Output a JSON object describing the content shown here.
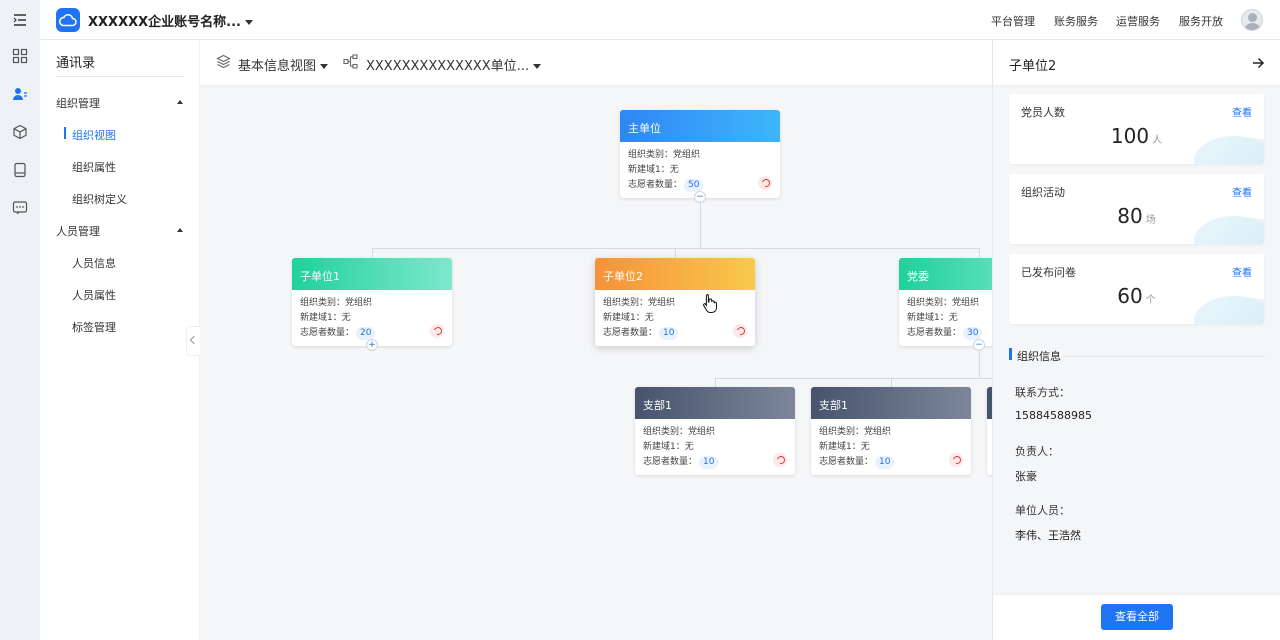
{
  "header": {
    "company": "XXXXXX企业账号名称...",
    "nav": [
      "平台管理",
      "账务服务",
      "运营服务",
      "服务开放"
    ]
  },
  "rail": {
    "icons": [
      "menu-icon",
      "grid-icon",
      "contacts-icon",
      "cube-icon",
      "device-icon",
      "message-icon"
    ]
  },
  "leftnav": {
    "title": "通讯录",
    "groups": [
      {
        "label": "组织管理",
        "items": [
          "组织视图",
          "组织属性",
          "组织树定义"
        ]
      },
      {
        "label": "人员管理",
        "items": [
          "人员信息",
          "人员属性",
          "标签管理"
        ]
      }
    ]
  },
  "canvas_head": {
    "view": "基本信息视图",
    "unit": "XXXXXXXXXXXXXX单位..."
  },
  "labels": {
    "category": "组织类别：",
    "field1": "新建域1：",
    "volunteers": "志愿者数量："
  },
  "cards": [
    {
      "title": "主单位",
      "category": "党组织",
      "field1": "无",
      "volunteers": "50",
      "toggle": "−"
    },
    {
      "title": "子单位1",
      "category": "党组织",
      "field1": "无",
      "volunteers": "20",
      "toggle": "+"
    },
    {
      "title": "子单位2",
      "category": "党组织",
      "field1": "无",
      "volunteers": "10"
    },
    {
      "title": "党委",
      "category": "党组织",
      "field1": "无",
      "volunteers": "30",
      "toggle": "−"
    },
    {
      "title": "支部1",
      "category": "党组织",
      "field1": "无",
      "volunteers": "10"
    },
    {
      "title": "支部1",
      "category": "党组织",
      "field1": "无",
      "volunteers": "10"
    }
  ],
  "panel": {
    "title": "子单位2",
    "link": "查看",
    "stats": [
      {
        "label": "党员人数",
        "value": "100",
        "unit": "人"
      },
      {
        "label": "组织活动",
        "value": "80",
        "unit": "场"
      },
      {
        "label": "已发布问卷",
        "value": "60",
        "unit": "个"
      }
    ],
    "info_title": "组织信息",
    "info": [
      {
        "key": "联系方式：",
        "value": "15884588985"
      },
      {
        "key": "负责人：",
        "value": "张豪"
      },
      {
        "key": "单位人员：",
        "value": "李伟、王浩然"
      }
    ],
    "button": "查看全部"
  },
  "colors": {
    "primary": "#1e74f2",
    "head_blue": "#2f86f5",
    "head_green": "#24d3a0",
    "head_orange": "#f7953a",
    "head_dark": "#4d5a73"
  }
}
